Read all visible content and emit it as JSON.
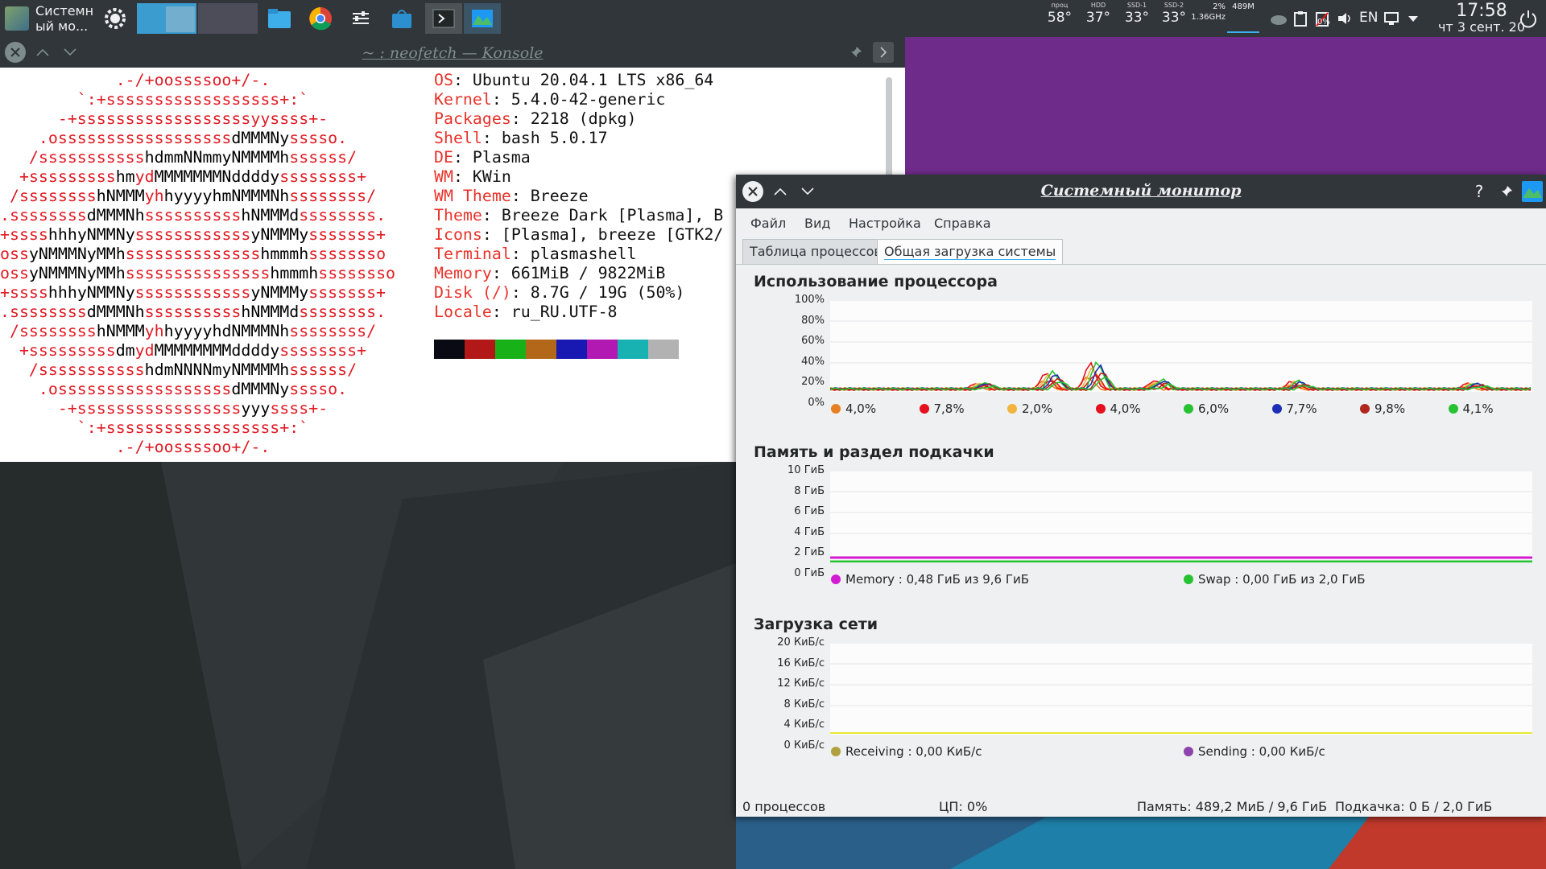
{
  "panel": {
    "task_label": "Системн ый мо...",
    "indicators": [
      {
        "caption": "проц",
        "value": "58°"
      },
      {
        "caption": "HDD",
        "value": "37°"
      },
      {
        "caption": "SSD-1",
        "value": "33°"
      },
      {
        "caption": "SSD-2",
        "value": "33°"
      }
    ],
    "cpu_percent": "2%",
    "cpu_freq": "1.36GHz",
    "mem_used": "489M",
    "battery_label": "0%",
    "keyboard_layout": "EN",
    "clock_time": "17:58",
    "clock_date": "чт 3 сент. 20"
  },
  "konsole": {
    "title": "~ : neofetch — Konsole",
    "logo_lines": [
      "            .-/+oossssoo+/-.",
      "        `:+ssssssssssssssssss+:`",
      "      -+ssssssssssssssssssyyssss+-",
      "    .ossssssssssssssssss[dMMMNy]sssso.",
      "   /sssssssssss[hdmmNNmmyNMMMMh]ssssss/",
      "  +sssssssss[hm]yd[MMMMMMMNddddy]ssssssss+",
      " /ssssssss[hNMMM]yh[hyyyyhmNMMMNh]ssssssss/",
      ".ssssssss[dMMMNh]ssssssssss[hNMMMd]ssssssss.",
      "+ssss[hhhyNMMNy]ssssssssssss[yNMMMy]sssssss+",
      "oss[yNMMMNyMMh]ssssssssssssss[hmmmh]ssssssso",
      "oss[yNMMMNyMMh]sssssssssssssss[hmmmh]ssssssso",
      "+ssss[hhhyNMMNy]ssssssssssss[yNMMMy]sssssss+",
      ".ssssssss[dMMMNh]ssssssssss[hNMMMd]ssssssss.",
      " /ssssssss[hNMMM]yh[hyyyyhdNMMMNh]ssssssss/",
      "  +sssssssss[dm]yd[MMMMMMMMddddy]ssssssss+",
      "   /sssssssssss[hdmNNNNmyNMMMMh]ssssss/",
      "    .ossssssssssssssssss[dMMMNy]sssso.",
      "      -+sssssssssssssssss[yyy]ssss+-",
      "        `:+ssssssssssssssssss+:`",
      "            .-/+oossssoo+/-."
    ],
    "info": [
      {
        "key": "OS",
        "value": "Ubuntu 20.04.1 LTS x86_64"
      },
      {
        "key": "Kernel",
        "value": "5.4.0-42-generic"
      },
      {
        "key": "Packages",
        "value": "2218 (dpkg)"
      },
      {
        "key": "Shell",
        "value": "bash 5.0.17"
      },
      {
        "key": "DE",
        "value": "Plasma"
      },
      {
        "key": "WM",
        "value": "KWin"
      },
      {
        "key": "WM Theme",
        "value": "Breeze"
      },
      {
        "key": "Theme",
        "value": "Breeze Dark [Plasma], B"
      },
      {
        "key": "Icons",
        "value": "[Plasma], breeze [GTK2/"
      },
      {
        "key": "Terminal",
        "value": "plasmashell"
      },
      {
        "key": "Memory",
        "value": "661MiB / 9822MiB"
      },
      {
        "key": "Disk (/)",
        "value": "8.7G / 19G (50%)"
      },
      {
        "key": "Locale",
        "value": "ru_RU.UTF-8"
      }
    ],
    "palette": [
      "#0a0a14",
      "#b21818",
      "#18b218",
      "#b26818",
      "#1818b2",
      "#b218b2",
      "#18b2b2",
      "#b2b2b2"
    ]
  },
  "sysmon": {
    "title": "Системный монитор",
    "menu": [
      "Файл",
      "Вид",
      "Настройка",
      "Справка"
    ],
    "tabs": [
      "Таблица процессов",
      "Общая загрузка системы"
    ],
    "cpu": {
      "title": "Использование процессора",
      "yticks": [
        "100%",
        "80%",
        "60%",
        "40%",
        "20%",
        "0%"
      ],
      "legend": [
        {
          "color": "#e67e22",
          "value": "4,0%"
        },
        {
          "color": "#e5111e",
          "value": "7,8%"
        },
        {
          "color": "#f2b43d",
          "value": "2,0%"
        },
        {
          "color": "#e5111e",
          "value": "4,0%"
        },
        {
          "color": "#27c232",
          "value": "6,0%"
        },
        {
          "color": "#1d2fb5",
          "value": "7,7%"
        },
        {
          "color": "#b0281d",
          "value": "9,8%"
        },
        {
          "color": "#27c232",
          "value": "4,1%"
        }
      ]
    },
    "memory": {
      "title": "Память и раздел подкачки",
      "yticks": [
        "10 ГиБ",
        "8 ГиБ",
        "6 ГиБ",
        "4 ГиБ",
        "2 ГиБ",
        "0 ГиБ"
      ],
      "legend": [
        {
          "color": "#d21ad2",
          "value": "Memory : 0,48 ГиБ из 9,6 ГиБ"
        },
        {
          "color": "#27c232",
          "value": "Swap : 0,00 ГиБ из 2,0 ГиБ"
        }
      ]
    },
    "network": {
      "title": "Загрузка сети",
      "yticks": [
        "20 КиБ/с",
        "16 КиБ/с",
        "12 КиБ/с",
        "8 КиБ/с",
        "4 КиБ/с",
        "0 КиБ/с"
      ],
      "legend": [
        {
          "color": "#b0a040",
          "value": "Receiving : 0,00 КиБ/с"
        },
        {
          "color": "#8e44ad",
          "value": "Sending : 0,00 КиБ/с"
        }
      ]
    },
    "status": {
      "processes": "0 процессов",
      "cpu": "ЦП: 0%",
      "memory": "Память: 489,2 МиБ / 9,6 ГиБ",
      "swap": "Подкачка: 0 Б / 2,0 ГиБ"
    }
  }
}
